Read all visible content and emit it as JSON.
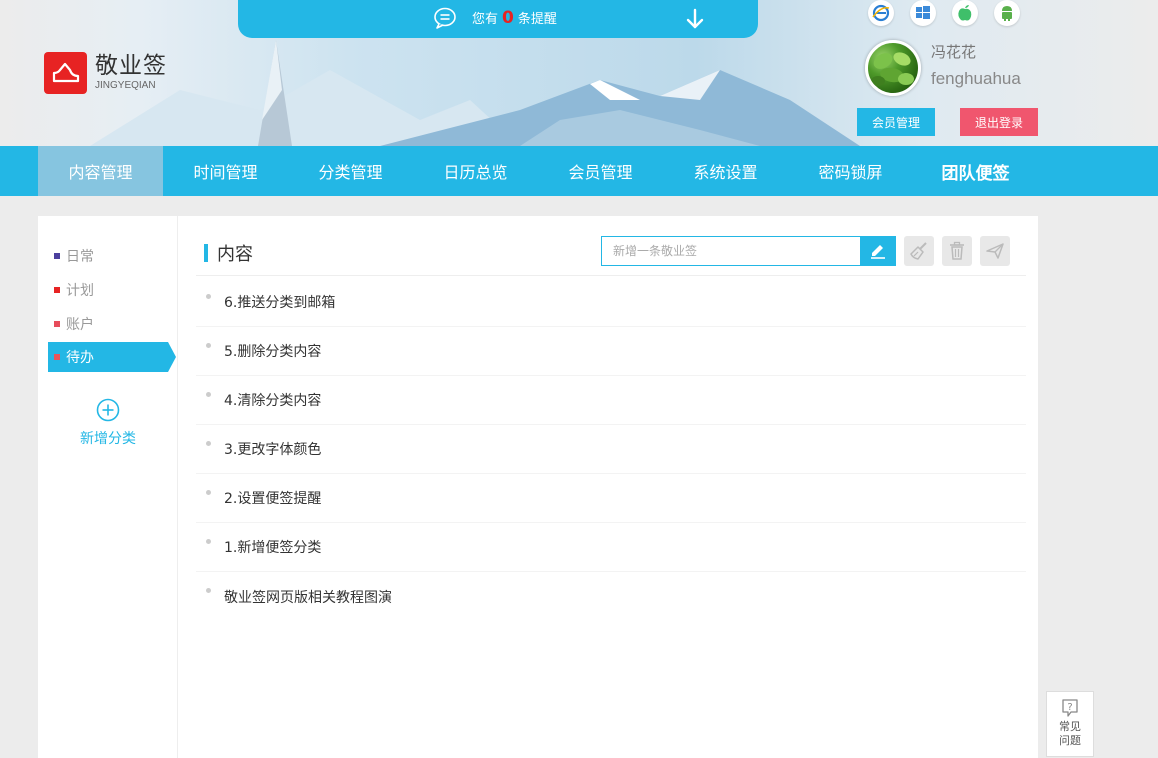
{
  "app": {
    "name": "敬业签",
    "sub": "JINGYEQIAN"
  },
  "remind": {
    "prefix": "您有",
    "count": "0",
    "suffix": "条提醒"
  },
  "platforms": [
    "ie-icon",
    "windows-icon",
    "apple-icon",
    "android-icon"
  ],
  "user": {
    "name_cn": "冯花花",
    "name_en": "fenghuahua",
    "member_button": "会员管理",
    "logout_button": "退出登录"
  },
  "nav": {
    "items": [
      {
        "label": "内容管理"
      },
      {
        "label": "时间管理"
      },
      {
        "label": "分类管理"
      },
      {
        "label": "日历总览"
      },
      {
        "label": "会员管理"
      },
      {
        "label": "系统设置"
      },
      {
        "label": "密码锁屏"
      },
      {
        "label": "团队便签"
      }
    ]
  },
  "sidebar": {
    "categories": [
      {
        "label": "日常",
        "color": "#4b3f9e"
      },
      {
        "label": "计划",
        "color": "#e72323"
      },
      {
        "label": "账户",
        "color": "#e74c5b"
      },
      {
        "label": "待办",
        "color": "#e8555b"
      }
    ],
    "add_label": "新增分类"
  },
  "content": {
    "title": "内容",
    "input_placeholder": "新增一条敬业签",
    "notes": [
      "6.推送分类到邮箱",
      "5.删除分类内容",
      "4.清除分类内容",
      "3.更改字体颜色",
      "2.设置便签提醒",
      "1.新增便签分类",
      "敬业签网页版相关教程图演"
    ]
  },
  "faq": {
    "line1": "常见",
    "line2": "问题"
  },
  "colors": {
    "accent": "#23b7e5",
    "logo": "#e72323",
    "logout": "#f0566e"
  }
}
